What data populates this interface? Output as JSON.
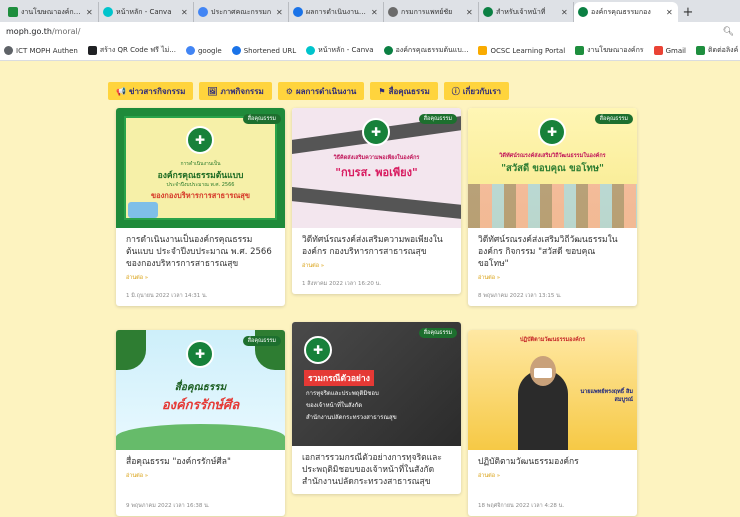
{
  "browser": {
    "tabs": [
      {
        "title": "งานโฆษณาองค์กร - ดี",
        "color": "#1e8e3e"
      },
      {
        "title": "หน้าหลัก - Canva",
        "color": "#00c4cc"
      },
      {
        "title": "ประกาศคณะกรรมก",
        "color": "#4285f4"
      },
      {
        "title": "ผลการดำเนินงานองค์",
        "color": "#1a73e8"
      },
      {
        "title": "กรมการแพทย์ชัย",
        "color": "#6b6b6b"
      },
      {
        "title": "สำหรับเจ้าหน้าที่",
        "color": "#0b8043"
      },
      {
        "title": "องค์กรคุณธรรมกอง",
        "color": "#0b8043"
      }
    ],
    "new_tab_label": "+",
    "url_host": "moph.go.th",
    "url_path": "/moral/",
    "bookmarks": [
      {
        "label": "ICT MOPH Authen",
        "color": "#5f6368"
      },
      {
        "label": "สร้าง QR Code ฟรี ไม่...",
        "color": "#202124"
      },
      {
        "label": "google",
        "color": "#4285f4"
      },
      {
        "label": "Shortened URL",
        "color": "#1a73e8"
      },
      {
        "label": "หน้าหลัก - Canva",
        "color": "#00c4cc"
      },
      {
        "label": "องค์กรคุณธรรมต้นแบ...",
        "color": "#0b8043"
      },
      {
        "label": "OCSC Learning Portal",
        "color": "#f9ab00"
      },
      {
        "label": "งานโฆษณาองค์กร",
        "color": "#1e8e3e"
      },
      {
        "label": "Gmail",
        "color": "#ea4335"
      },
      {
        "label": "ติดต่อลิงค์ 5 ส.",
        "color": "#1e8e3e"
      }
    ]
  },
  "nav": [
    {
      "icon": "megaphone-icon",
      "glyph": "📢",
      "label": "ข่าวสารกิจกรรม"
    },
    {
      "icon": "image-icon",
      "glyph": "🖼",
      "label": "ภาพกิจกรรม"
    },
    {
      "icon": "gear-icon",
      "glyph": "⚙",
      "label": "ผลการดำเนินงาน"
    },
    {
      "icon": "flag-icon",
      "glyph": "⚑",
      "label": "สื่อคุณธรรม"
    },
    {
      "icon": "info-icon",
      "glyph": "ⓘ",
      "label": "เกี่ยวกับเรา"
    }
  ],
  "category_badge": "สื่อคุณธรรม",
  "read_more": "อ่านต่อ »",
  "cards": [
    {
      "thumb_lines": [
        "การดำเนินงานเป็น",
        "องค์กรคุณธรรมต้นแบบ",
        "ประจำปีงบประมาณ พ.ศ. 2566",
        "ของกองบริหารการสาธารณสุข"
      ],
      "title": "การดำเนินงานเป็นองค์กรคุณธรรมต้นแบบ ประจำปีงบประมาณ พ.ศ. 2566 ของกองบริหารการสาธารณสุข",
      "date": "1 มิ.ถุนายน 2022  เวลา  14:31 น."
    },
    {
      "thumb_lines": [
        "วิธีคิดส่งเสริมความพอเพียงในองค์กร",
        "\"กบรส. พอเพียง\""
      ],
      "title": "วิดีทัศน์รณรงค์ส่งเสริมความพอเพียงในองค์กร กองบริหารการสาธารณสุข",
      "date": "1 สิงหาคม 2022  เวลา  16:20 น."
    },
    {
      "thumb_lines": [
        "วิดีทัศน์รณรงค์ส่งเสริมวิถีวัฒนธรรมในองค์กร",
        "\"สวัสดี ขอบคุณ ขอโทษ\""
      ],
      "title": "วิดีทัศน์รณรงค์ส่งเสริมวิถีวัฒนธรรมในองค์กร กิจกรรม \"สวัสดี ขอบคุณ ขอโทษ\"",
      "date": "8 พฤษภาคม 2022  เวลา  13:15 น."
    },
    {
      "thumb_lines": [
        "สื่อคุณธรรม",
        "องค์กรรักษ์ศีล"
      ],
      "title": "สื่อคุณธรรม \"องค์กรรักษ์ศีล\"",
      "date": "9 พฤษภาคม 2022  เวลา  16:38 น."
    },
    {
      "thumb_lines": [
        "รวมกรณีตัวอย่าง",
        "การทุจริตและประพฤติมิชอบ",
        "ของเจ้าหน้าที่ในสังกัด",
        "สำนักงานปลัดกระทรวงสาธารณสุข"
      ],
      "title": "เอกสารรวมกรณีตัวอย่างการทุจริตและประพฤติมิชอบของเจ้าหน้าที่ในสังกัดสำนักงานปลัดกระทรวงสาธารณสุข",
      "date": ""
    },
    {
      "thumb_lines": [
        "ปฏิบัติตามวัฒนธรรมองค์กร",
        "นายแพทย์ทรงฤทธิ์ สิมสมบูรณ์"
      ],
      "title": "ปฏิบัติตามวัฒนธรรมองค์กร",
      "date": "18 พฤศจิกายน 2022  เวลา  4:28 น."
    }
  ]
}
